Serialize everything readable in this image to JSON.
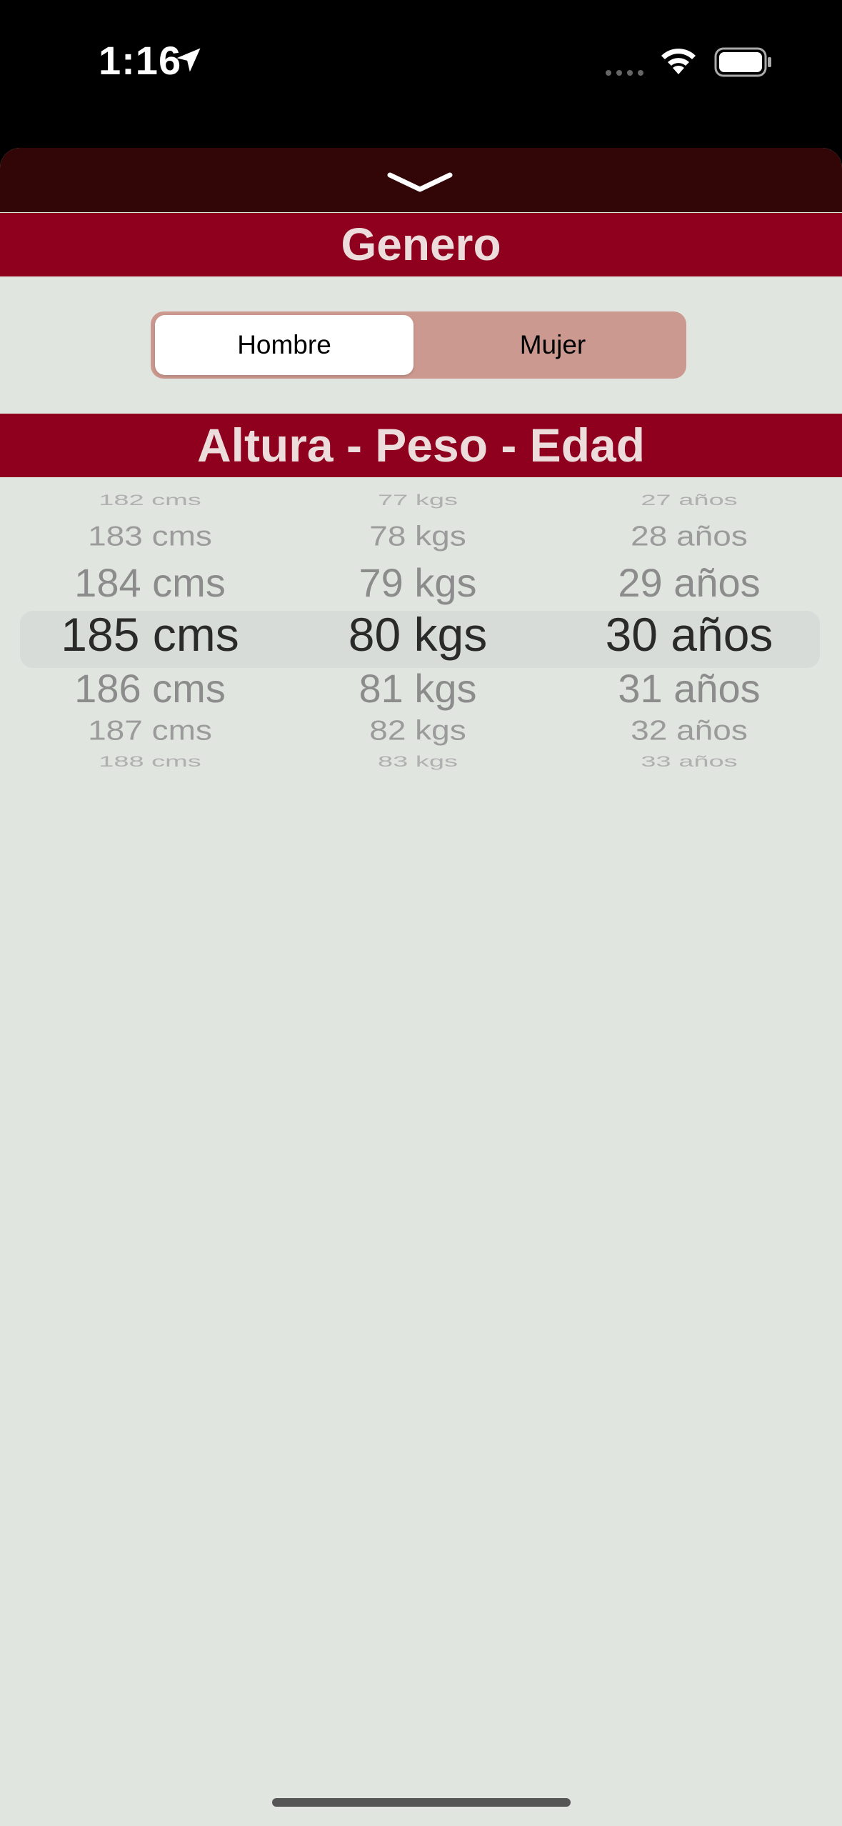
{
  "status_bar": {
    "time": "1:16"
  },
  "sheet": {
    "genero_header": "Genero",
    "gender_segment": {
      "options": [
        "Hombre",
        "Mujer"
      ],
      "selected": "Hombre"
    },
    "measures_header": "Altura - Peso - Edad",
    "picker": {
      "height": [
        "182 cms",
        "183 cms",
        "184 cms",
        "185 cms",
        "186 cms",
        "187 cms",
        "188 cms"
      ],
      "weight": [
        "77 kgs",
        "78 kgs",
        "79 kgs",
        "80 kgs",
        "81 kgs",
        "82 kgs",
        "83 kgs"
      ],
      "age": [
        "27 años",
        "28 años",
        "29 años",
        "30 años",
        "31 años",
        "32 años",
        "33 años"
      ],
      "selected": {
        "height": "185 cms",
        "weight": "80 kgs",
        "age": "30 años"
      }
    }
  },
  "colors": {
    "header_red": "#8e001d",
    "grab_bar": "#320606",
    "segment_bg": "#cc9990",
    "sheet_bg": "#e0e5e0"
  }
}
